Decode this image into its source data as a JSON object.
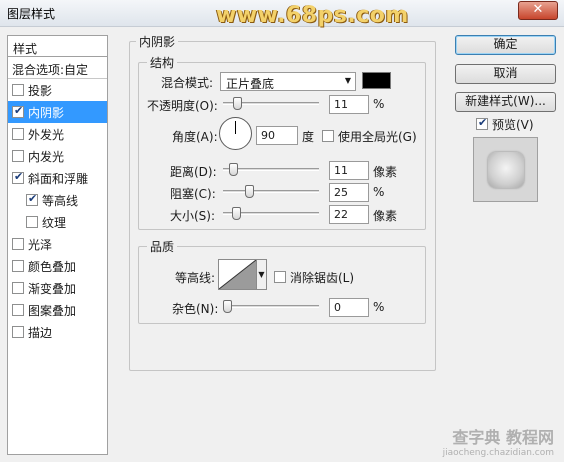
{
  "window": {
    "title": "图层样式",
    "close_label": "✕",
    "watermark": "www.68ps.com"
  },
  "styles": {
    "header": "样式",
    "blend_options": "混合选项:自定",
    "items": [
      {
        "label": "投影",
        "checked": false,
        "selected": false,
        "indent": false
      },
      {
        "label": "内阴影",
        "checked": true,
        "selected": true,
        "indent": false
      },
      {
        "label": "外发光",
        "checked": false,
        "selected": false,
        "indent": false
      },
      {
        "label": "内发光",
        "checked": false,
        "selected": false,
        "indent": false
      },
      {
        "label": "斜面和浮雕",
        "checked": true,
        "selected": false,
        "indent": false
      },
      {
        "label": "等高线",
        "checked": true,
        "selected": false,
        "indent": true
      },
      {
        "label": "纹理",
        "checked": false,
        "selected": false,
        "indent": true
      },
      {
        "label": "光泽",
        "checked": false,
        "selected": false,
        "indent": false
      },
      {
        "label": "颜色叠加",
        "checked": false,
        "selected": false,
        "indent": false
      },
      {
        "label": "渐变叠加",
        "checked": false,
        "selected": false,
        "indent": false
      },
      {
        "label": "图案叠加",
        "checked": false,
        "selected": false,
        "indent": false
      },
      {
        "label": "描边",
        "checked": false,
        "selected": false,
        "indent": false
      }
    ]
  },
  "inner_shadow": {
    "title": "内阴影",
    "structure": {
      "title": "结构",
      "blend_mode_label": "混合模式:",
      "blend_mode_value": "正片叠底",
      "shadow_color": "#000000",
      "opacity_label": "不透明度(O):",
      "opacity_value": "11",
      "opacity_fraction": 0.11,
      "opacity_unit": "%",
      "angle_label": "角度(A):",
      "angle_value": "90",
      "angle_unit": "度",
      "global_light_label": "使用全局光(G)",
      "global_light_checked": false,
      "distance_label": "距离(D):",
      "distance_value": "11",
      "distance_unit": "像素",
      "choke_label": "阻塞(C):",
      "choke_value": "25",
      "choke_fraction": 0.25,
      "choke_unit": "%",
      "size_label": "大小(S):",
      "size_value": "22",
      "size_unit": "像素"
    },
    "quality": {
      "title": "品质",
      "contour_label": "等高线:",
      "antialias_label": "消除锯齿(L)",
      "antialias_checked": false,
      "noise_label": "杂色(N):",
      "noise_value": "0",
      "noise_fraction": 0,
      "noise_unit": "%"
    }
  },
  "buttons": {
    "ok": "确定",
    "cancel": "取消",
    "new_style": "新建样式(W)...",
    "preview_label": "预览(V)",
    "preview_checked": true
  },
  "footer": {
    "mark": "查字典 教程网",
    "url": "jiaocheng.chazidian.com"
  }
}
